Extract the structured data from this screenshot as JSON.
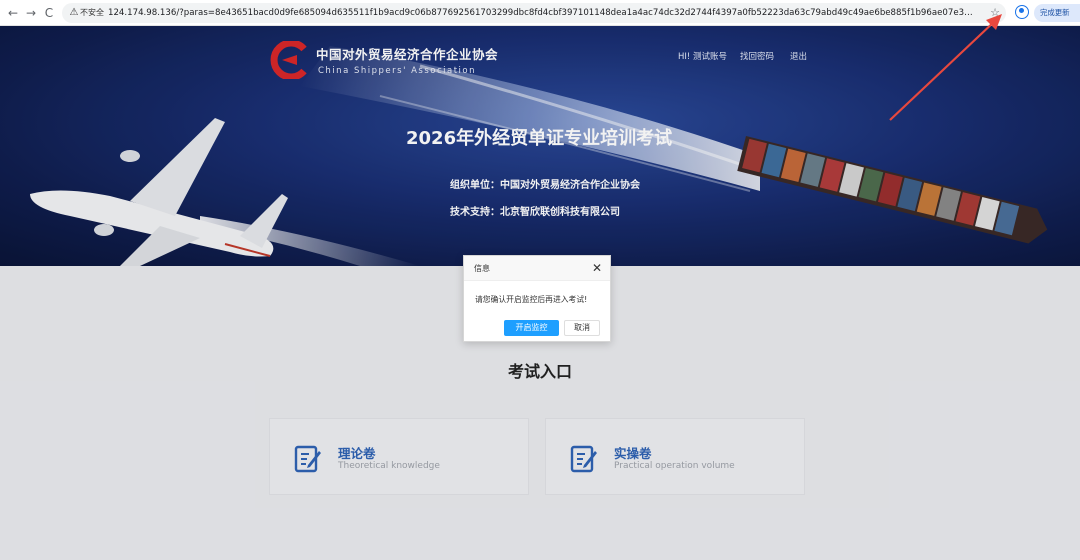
{
  "browser": {
    "back_icon": "←",
    "forward_icon": "→",
    "reload_icon": "C",
    "insecure_label": "不安全",
    "url": "124.174.98.136/?paras=8e43651bacd0d9fe685094d635511f1b9acd9c06b877692561703299dbc8fd4cbf397101148dea1a4ac74dc32d2744f4397a0fb52223da63c79abd49c49ae6be885f1b96ae07e34a5e39dba09e1c34047f895910...",
    "update_label": "完成更新"
  },
  "header": {
    "logo_cn": "中国对外贸易经济合作企业协会",
    "logo_en": "China Shippers' Association",
    "nav": [
      "HI! 测试账号",
      "找回密码",
      "退出"
    ]
  },
  "hero": {
    "title": "2026年外经贸单证专业培训考试",
    "organizer": "组织单位：中国对外贸易经济合作企业协会",
    "tech_support": "技术支持：北京智欣联创科技有限公司"
  },
  "dialog": {
    "title": "信息",
    "close": "✕",
    "message": "请您确认开启监控后再进入考试!",
    "confirm": "开启监控",
    "cancel": "取消"
  },
  "entry": {
    "title": "考试入口",
    "cards": [
      {
        "title": "理论卷",
        "subtitle": "Theoretical knowledge"
      },
      {
        "title": "实操卷",
        "subtitle": "Practical operation volume"
      }
    ]
  },
  "colors": {
    "primary": "#1e9fff",
    "card_title": "#2f63b4",
    "hero_dark": "#0f1d4d",
    "annotation": "#e8483e"
  }
}
